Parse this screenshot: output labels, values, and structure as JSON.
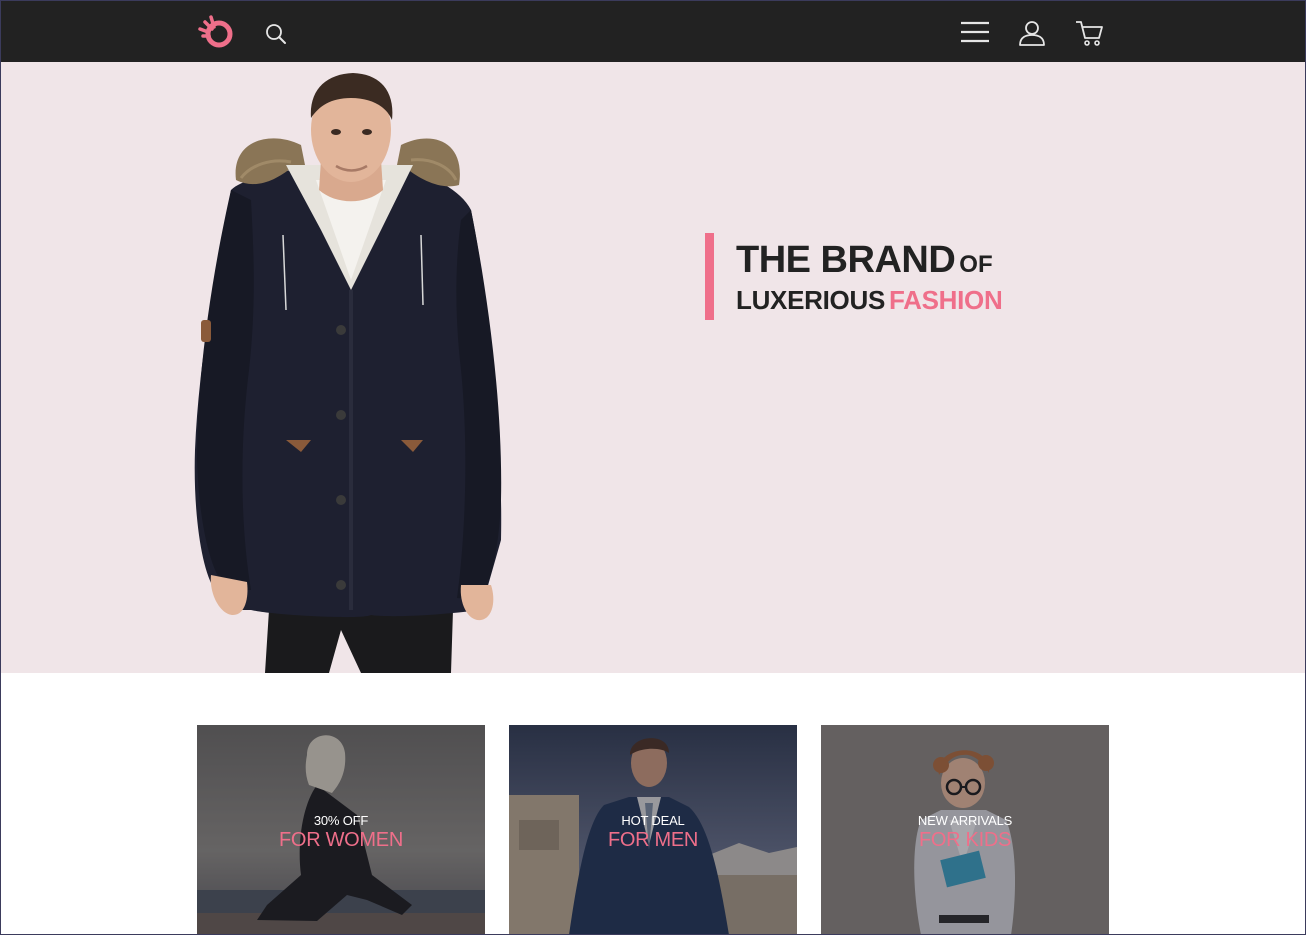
{
  "header": {
    "logo_icon": "hand-ok-logo-icon",
    "search_icon": "search-icon",
    "menu_icon": "hamburger-menu-icon",
    "account_icon": "user-icon",
    "cart_icon": "shopping-cart-icon"
  },
  "hero": {
    "headline": {
      "line1_main": "THE BRAND",
      "line1_small": "OF",
      "line2_main": "LUXERIOUS",
      "line2_accent": "FASHION"
    },
    "image": "man-in-black-parka-with-fur-hood"
  },
  "categories": [
    {
      "kicker": "30% OFF",
      "title": "FOR WOMEN",
      "image": "woman-in-black-sitting-by-sea"
    },
    {
      "kicker": "HOT DEAL",
      "title": "FOR MEN",
      "image": "man-in-blue-suit-rooftop"
    },
    {
      "kicker": "NEW ARRIVALS",
      "title": "FOR KIDS",
      "image": "curly-haired-boy-with-glasses-and-book"
    }
  ],
  "colors": {
    "header_bg": "#222222",
    "hero_bg": "#f0e5e8",
    "accent": "#ef6f8a",
    "text_dark": "#222222"
  }
}
